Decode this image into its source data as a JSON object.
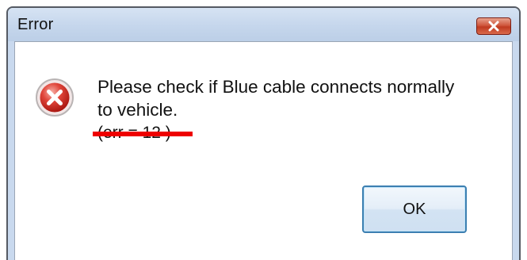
{
  "window": {
    "title": "Error",
    "close_icon": "close-x-icon"
  },
  "dialog": {
    "icon": "error-icon",
    "message": "Please check if Blue cable connects normally\nto vehicle.",
    "error_code": "(err = 12 )",
    "annotation_color": "#ee0000"
  },
  "buttons": {
    "ok_label": "OK"
  }
}
